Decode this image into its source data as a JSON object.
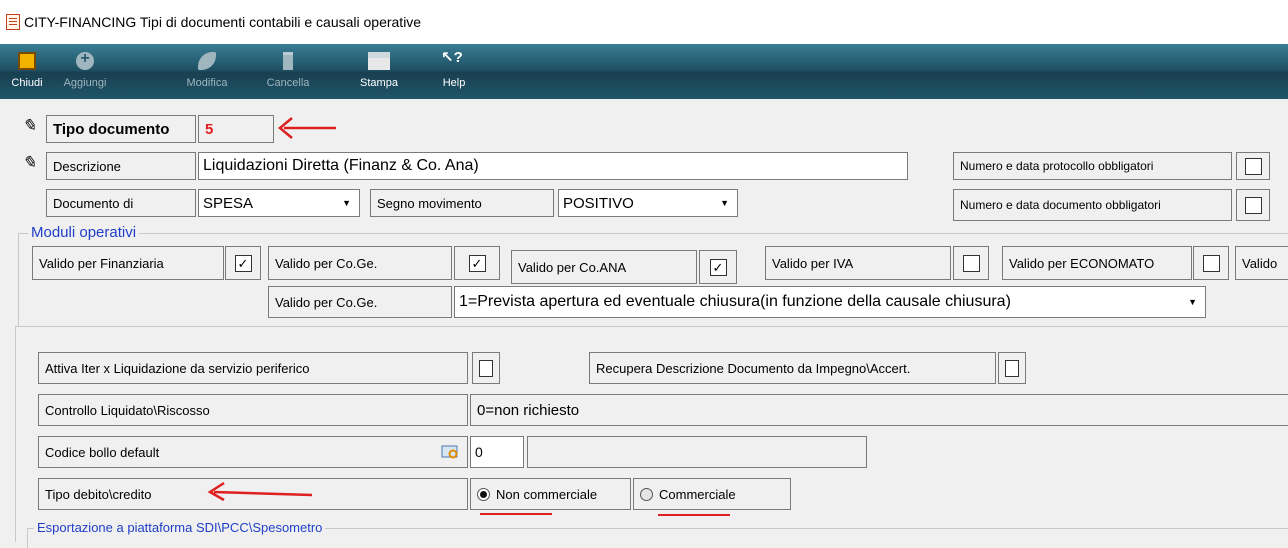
{
  "window": {
    "title": "CITY-FINANCING  Tipi di documenti contabili e causali operative",
    "icon": "document-list-icon"
  },
  "toolbar": {
    "buttons": [
      {
        "label": "Chiudi",
        "icon": "exit-door-icon",
        "enabled": true
      },
      {
        "label": "Aggiungi",
        "icon": "add-icon",
        "enabled": false
      },
      {
        "label": "Modifica",
        "icon": "edit-icon",
        "enabled": false
      },
      {
        "label": "Cancella",
        "icon": "trash-icon",
        "enabled": false
      },
      {
        "label": "Stampa",
        "icon": "printer-icon",
        "enabled": true
      },
      {
        "label": "Help",
        "icon": "help-pointer-icon",
        "enabled": true
      }
    ]
  },
  "header": {
    "tipo_documento_label": "Tipo documento",
    "tipo_documento_value": "5",
    "descrizione_label": "Descrizione",
    "descrizione_value": "Liquidazioni  Diretta  (Finanz & Co. Ana)",
    "documento_di_label": "Documento di",
    "documento_di_value": "SPESA",
    "segno_movimento_label": "Segno movimento",
    "segno_movimento_value": "POSITIVO",
    "protocollo_label": "Numero e data protocollo obbligatori",
    "protocollo_checked": false,
    "documento_obbl_label": "Numero e data documento obbligatori",
    "documento_obbl_checked": false
  },
  "moduli": {
    "title": "Moduli operativi",
    "items": [
      {
        "label": "Valido per Finanziaria",
        "checked": true
      },
      {
        "label": "Valido per Co.Ge.",
        "checked": true
      },
      {
        "label": "Valido per Co.ANA",
        "checked": true
      },
      {
        "label": "Valido per IVA",
        "checked": false
      },
      {
        "label": "Valido per ECONOMATO",
        "checked": false
      },
      {
        "label": "Valido",
        "checked": false
      }
    ],
    "coge_label": "Valido per Co.Ge.",
    "coge_value": "1=Prevista apertura ed eventuale chiusura(in funzione della causale chiusura)"
  },
  "details": {
    "iter_label": "Attiva Iter x Liquidazione da servizio periferico",
    "iter_checked": false,
    "recupera_label": "Recupera Descrizione Documento da Impegno\\Accert.",
    "recupera_checked": false,
    "controllo_label": "Controllo Liquidato\\Riscosso",
    "controllo_value": "0=non richiesto",
    "bollo_label": "Codice bollo default",
    "bollo_value": "0",
    "tipo_debito_label": "Tipo debito\\credito",
    "radio_non_commerciale": "Non commerciale",
    "radio_commerciale": "Commerciale",
    "selected": "Non commerciale"
  },
  "esportazione": {
    "title": "Esportazione a piattaforma SDI\\PCC\\Spesometro"
  },
  "annotation_color": "#e02020"
}
